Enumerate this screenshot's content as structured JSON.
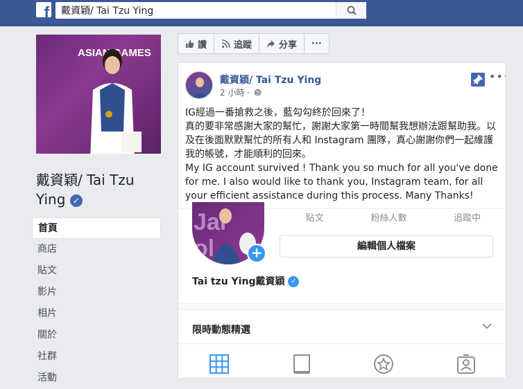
{
  "topbar": {
    "logo_letter": "f",
    "search_value": "戴資穎/ Tai Tzu Ying"
  },
  "sidebar": {
    "cover_text_top": "ASIAN GAMES",
    "cover_text_big": "Jal\nPal",
    "page_name": "戴資穎/ Tai Tzu Ying",
    "items": [
      {
        "label": "首頁"
      },
      {
        "label": "商店"
      },
      {
        "label": "貼文"
      },
      {
        "label": "影片"
      },
      {
        "label": "相片"
      },
      {
        "label": "關於"
      },
      {
        "label": "社群"
      },
      {
        "label": "活動"
      }
    ]
  },
  "actions": {
    "like": "讚",
    "follow": "追蹤",
    "share": "分享",
    "more": "···"
  },
  "post": {
    "author": "戴資穎/ Tai Tzu Ying",
    "time": "2 小時 ·",
    "text_zh_1": "IG經過一番搶救之後，藍勾勾終於回來了！",
    "text_zh_2": "真的要非常感謝大家的幫忙，謝謝大家第一時間幫我想辦法跟幫助我。以及在後面默默幫忙的所有人和 Instagram 團隊，真心謝謝你們一起維護我的帳號，才能順利的回來。",
    "text_en": "My IG account survived ! Thank you so much for all you've done for me. I also would like to thank you, Instagram team, for all your efficient assistance during this process. Many Thanks!"
  },
  "instagram": {
    "stats": [
      {
        "label": "貼文"
      },
      {
        "label": "粉絲人數"
      },
      {
        "label": "追蹤中"
      }
    ],
    "edit_profile": "編輯個人檔案",
    "username": "Tai tzu Ying戴資穎",
    "highlights": "限時動態精選"
  },
  "colors": {
    "facebook_blue": "#3b5998",
    "link_blue": "#385898",
    "instagram_blue": "#3897f0"
  }
}
